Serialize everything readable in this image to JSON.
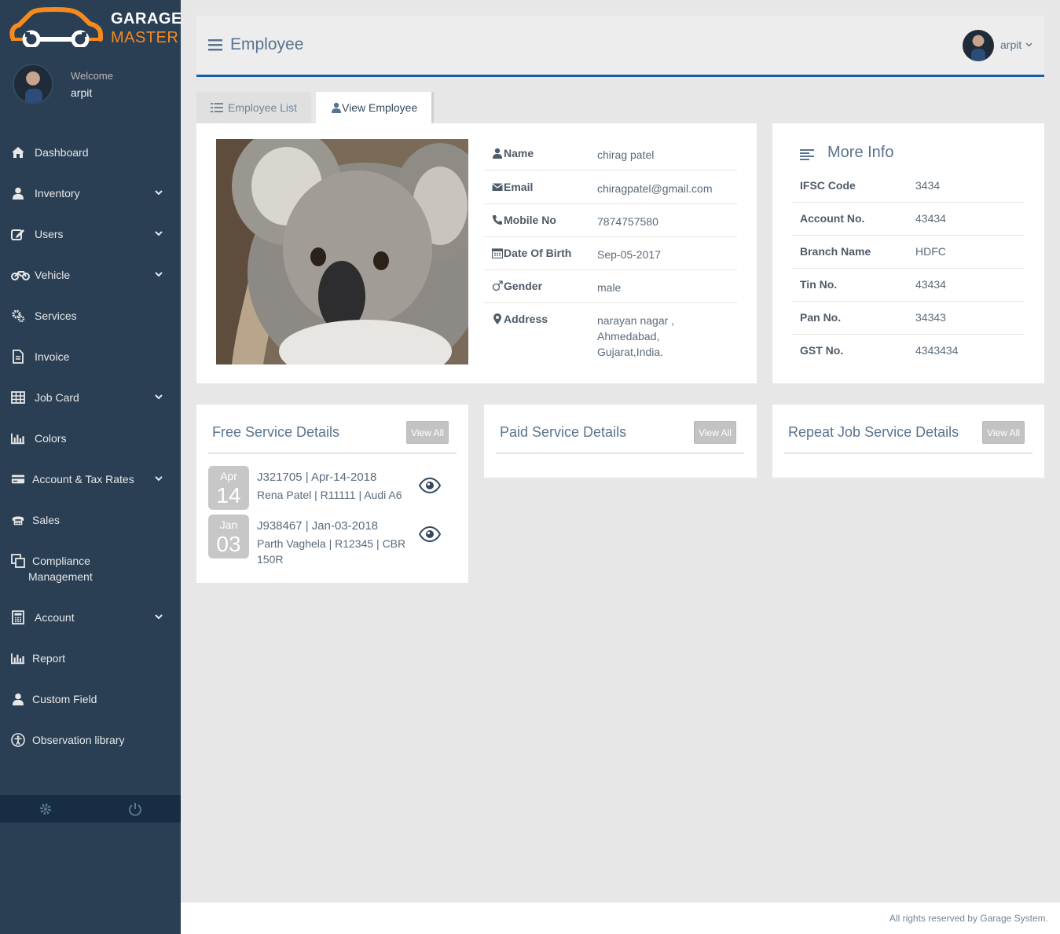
{
  "brand": {
    "line1": "GARAGE",
    "line2": "MASTER",
    "accent": "#f68a1f"
  },
  "sidebar": {
    "welcome": "Welcome",
    "user": "arpit",
    "items": [
      {
        "label": "Dashboard",
        "icon": "home-icon",
        "chevron": false
      },
      {
        "label": "Inventory",
        "icon": "user-icon",
        "chevron": true
      },
      {
        "label": "Users",
        "icon": "edit-icon",
        "chevron": true
      },
      {
        "label": "Vehicle",
        "icon": "motorcycle-icon",
        "chevron": true
      },
      {
        "label": "Services",
        "icon": "gears-icon",
        "chevron": false
      },
      {
        "label": "Invoice",
        "icon": "file-icon",
        "chevron": false
      },
      {
        "label": "Job Card",
        "icon": "table-icon",
        "chevron": true
      },
      {
        "label": "Colors",
        "icon": "bar-chart-icon",
        "chevron": false
      },
      {
        "label": "Account & Tax Rates",
        "icon": "credit-card-icon",
        "chevron": true
      },
      {
        "label": "Sales",
        "icon": "fax-icon",
        "chevron": false
      },
      {
        "label": "Compliance",
        "label2": "Management",
        "icon": "clone-icon",
        "chevron": false
      },
      {
        "label": "Account",
        "icon": "calculator-icon",
        "chevron": true
      },
      {
        "label": "Report",
        "icon": "bar-chart-icon",
        "chevron": false
      },
      {
        "label": "Custom Field",
        "icon": "user-icon",
        "chevron": false
      },
      {
        "label": "Observation library",
        "icon": "universal-access-icon",
        "chevron": false
      }
    ]
  },
  "header": {
    "title": "Employee",
    "user": "arpit"
  },
  "tabs": {
    "list": "Employee List",
    "view": "View Employee"
  },
  "employee": {
    "rows": [
      {
        "label": "Name",
        "value": "chirag patel",
        "icon": "user-icon"
      },
      {
        "label": "Email",
        "value": "chiragpatel@gmail.com",
        "icon": "envelope-icon"
      },
      {
        "label": "Mobile No",
        "value": "7874757580",
        "icon": "phone-icon"
      },
      {
        "label": "Date Of Birth",
        "value": "Sep-05-2017",
        "icon": "calendar-icon"
      },
      {
        "label": "Gender",
        "value": "male",
        "icon": "mars-icon"
      },
      {
        "label": "Address",
        "value": "narayan nagar ,\nAhmedabad,\nGujarat,India.",
        "icon": "map-marker-icon"
      }
    ]
  },
  "more_info": {
    "title": "More Info",
    "rows": [
      {
        "label": "IFSC Code",
        "value": "3434"
      },
      {
        "label": "Account No.",
        "value": "43434"
      },
      {
        "label": "Branch Name",
        "value": "HDFC"
      },
      {
        "label": "Tin No.",
        "value": "43434"
      },
      {
        "label": "Pan No.",
        "value": "34343"
      },
      {
        "label": "GST No.",
        "value": "4343434"
      }
    ]
  },
  "services": {
    "free": {
      "title": "Free Service Details",
      "btn": "View All",
      "items": [
        {
          "month": "Apr",
          "day": "14",
          "line1": "J321705 | Apr-14-2018",
          "line2": "Rena Patel | R11111 | Audi A6"
        },
        {
          "month": "Jan",
          "day": "03",
          "line1": "J938467 | Jan-03-2018",
          "line2": "Parth Vaghela | R12345 | CBR 150R"
        }
      ]
    },
    "paid": {
      "title": "Paid Service Details",
      "btn": "View All"
    },
    "repeat": {
      "title": "Repeat Job Service Details",
      "btn": "View All"
    }
  },
  "footer": {
    "text": "All rights reserved by Garage System."
  },
  "colors": {
    "sidebar": "#2a3f54",
    "header_border": "#1a5ca8",
    "accent_orange": "#f68a1f"
  }
}
